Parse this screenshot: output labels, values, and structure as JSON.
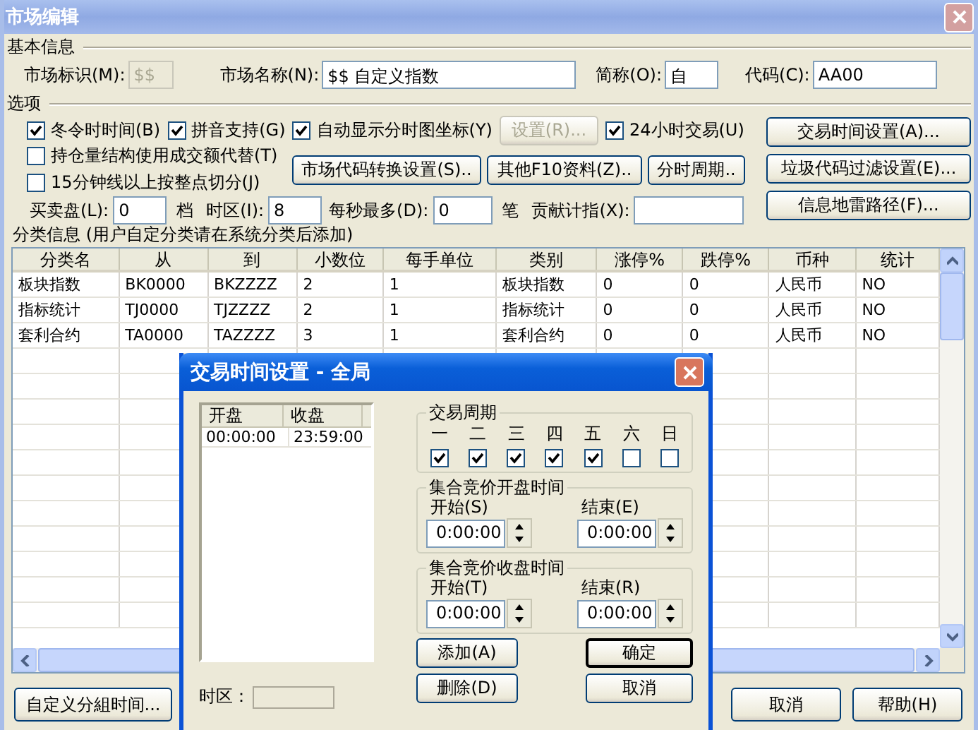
{
  "window": {
    "title": "市场编辑"
  },
  "basic_info": {
    "heading": "基本信息",
    "fields": [
      {
        "label": "市场标识(M):",
        "value": "$$",
        "disabled": true
      },
      {
        "label": "市场名称(N):",
        "value": "$$ 自定义指数",
        "disabled": false
      },
      {
        "label": "简称(O):",
        "value": "自",
        "disabled": false
      },
      {
        "label": "代码(C):",
        "value": "AA00",
        "disabled": false
      }
    ]
  },
  "options": {
    "heading": "选项",
    "top_row": [
      {
        "kind": "checkbox",
        "label": "冬令时时间(B)",
        "checked": true
      },
      {
        "kind": "checkbox",
        "label": "拼音支持(G)",
        "checked": true
      },
      {
        "kind": "checkbox",
        "label": "自动显示分时图坐标(Y)",
        "checked": true
      },
      {
        "kind": "button",
        "label": "设置(R)...",
        "disabled": true
      },
      {
        "kind": "checkbox",
        "label": "24小时交易(U)",
        "checked": true
      }
    ],
    "left_checkboxes": [
      {
        "label": "持仓量结构使用成交额代替(T)",
        "checked": false
      },
      {
        "label": "15分钟线以上按整点切分(J)",
        "checked": false
      }
    ],
    "middle_buttons": [
      "市场代码转换设置(S)..",
      "其他F10资料(Z)..",
      "分时周期.."
    ],
    "input_row": [
      {
        "kind": "field",
        "label": "买卖盘(L):",
        "value": "0"
      },
      {
        "kind": "text",
        "label": "档"
      },
      {
        "kind": "field",
        "label": "时区(I):",
        "value": "8"
      },
      {
        "kind": "field",
        "label": "每秒最多(D):",
        "value": "0"
      },
      {
        "kind": "text",
        "label": "笔"
      },
      {
        "kind": "field",
        "label": "贡献计指(X):"
      }
    ],
    "right_buttons": [
      "交易时间设置(A)...",
      "垃圾代码过滤设置(E)...",
      "信息地雷路径(F)..."
    ]
  },
  "categories": {
    "heading": "分类信息 (用户自定分类请在系统分类后添加)",
    "columns": [
      "分类名",
      "从",
      "到",
      "小数位",
      "每手单位",
      "类别",
      "涨停%",
      "跌停%",
      "币种",
      "统计"
    ],
    "rows": [
      [
        "板块指数",
        "BK0000",
        "BKZZZZ",
        "2",
        "1",
        "板块指数",
        "0",
        "0",
        "人民币",
        "NO"
      ],
      [
        "指标统计",
        "TJ0000",
        "TJZZZZ",
        "2",
        "1",
        "指标统计",
        "0",
        "0",
        "人民币",
        "NO"
      ],
      [
        "套利合约",
        "TA0000",
        "TAZZZZ",
        "3",
        "1",
        "套利合约",
        "0",
        "0",
        "人民币",
        "NO"
      ]
    ]
  },
  "bottom_buttons": [
    "自定义分組时间...",
    "取消",
    "帮助(H)"
  ],
  "dialog": {
    "title": "交易时间设置 - 全局",
    "sessions": {
      "columns": [
        "开盘",
        "收盘"
      ],
      "rows": [
        [
          "00:00:00",
          "23:59:00"
        ]
      ]
    },
    "timezone_label": "时区：",
    "week": {
      "heading": "交易周期",
      "days": [
        {
          "label": "一",
          "checked": true
        },
        {
          "label": "二",
          "checked": true
        },
        {
          "label": "三",
          "checked": true
        },
        {
          "label": "四",
          "checked": true
        },
        {
          "label": "五",
          "checked": true
        },
        {
          "label": "六",
          "checked": false
        },
        {
          "label": "日",
          "checked": false
        }
      ]
    },
    "auctions": [
      {
        "heading": "集合竞价开盘时间",
        "start": {
          "label": "开始(S)",
          "value": "0:00:00"
        },
        "end": {
          "label": "结束(E)",
          "value": "0:00:00"
        }
      },
      {
        "heading": "集合竞价收盘时间",
        "start": {
          "label": "开始(T)",
          "value": "0:00:00"
        },
        "end": {
          "label": "结束(R)",
          "value": "0:00:00"
        }
      }
    ],
    "buttons": [
      {
        "label": "添加(A)",
        "default": false
      },
      {
        "label": "确定",
        "default": true
      },
      {
        "label": "删除(D)",
        "default": false
      },
      {
        "label": "取消",
        "default": false
      }
    ]
  }
}
